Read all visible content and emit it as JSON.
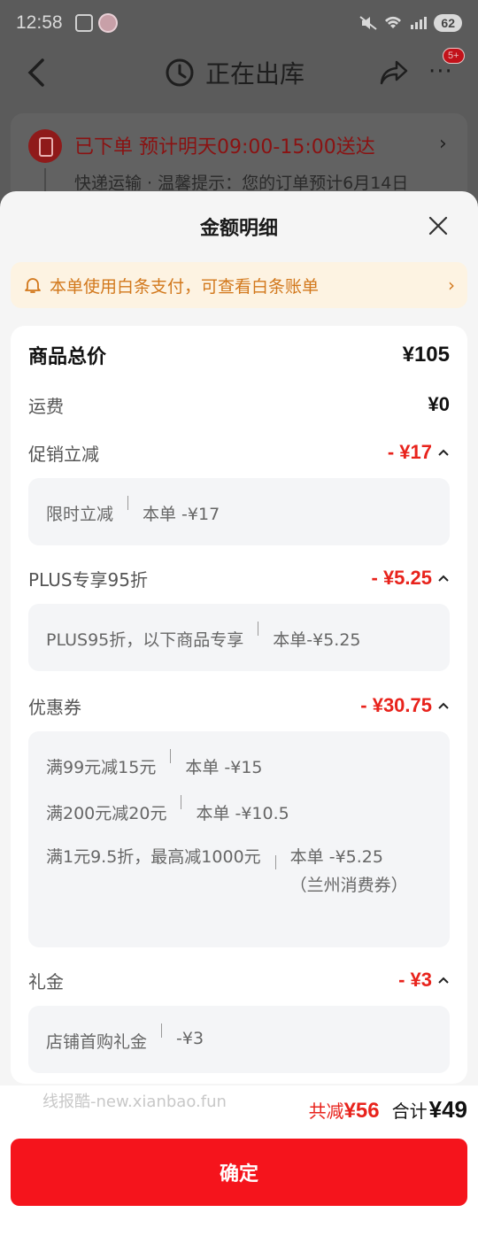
{
  "status_bar": {
    "time": "12:58",
    "battery": "62"
  },
  "nav": {
    "title": "正在出库",
    "badge": "5+"
  },
  "order": {
    "status": "已下单 预计明天09:00-15:00送达",
    "sub": "快递运输 · 温馨提示：您的订单预计6月14日"
  },
  "sheet": {
    "title": "金额明细",
    "notice": "本单使用白条支付，可查看白条账单",
    "goods_total": {
      "label": "商品总价",
      "value": "¥105"
    },
    "shipping": {
      "label": "运费",
      "value": "¥0"
    },
    "promo": {
      "label": "促销立减",
      "value": "- ¥17",
      "items": [
        {
          "name": "限时立减",
          "amount": "本单 -¥17"
        }
      ]
    },
    "plus": {
      "label": "PLUS专享95折",
      "value": "- ¥5.25",
      "items": [
        {
          "name": "PLUS95折，以下商品专享",
          "amount": "本单-¥5.25"
        }
      ]
    },
    "coupon": {
      "label": "优惠券",
      "value": "- ¥30.75",
      "items": [
        {
          "name": "满99元减15元",
          "amount": "本单 -¥15"
        },
        {
          "name": "满200元减20元",
          "amount": "本单 -¥10.5"
        },
        {
          "name": "满1元9.5折，最高减1000元",
          "amount": "本单 -¥5.25（兰州消费券）"
        }
      ]
    },
    "gift": {
      "label": "礼金",
      "value": "- ¥3",
      "items": [
        {
          "name": "店铺首购礼金",
          "amount": "-¥3"
        }
      ]
    }
  },
  "footer": {
    "watermark": "线报酷-new.xianbao.fun",
    "discount_label": "共减",
    "discount_value": "¥56",
    "total_label": "合计",
    "total_value": "¥49",
    "confirm_label": "确定"
  },
  "colors": {
    "accent_red": "#e8231c",
    "button_red": "#f5141c",
    "notice_orange": "#d2781c",
    "notice_bg": "#fdf3e2"
  }
}
